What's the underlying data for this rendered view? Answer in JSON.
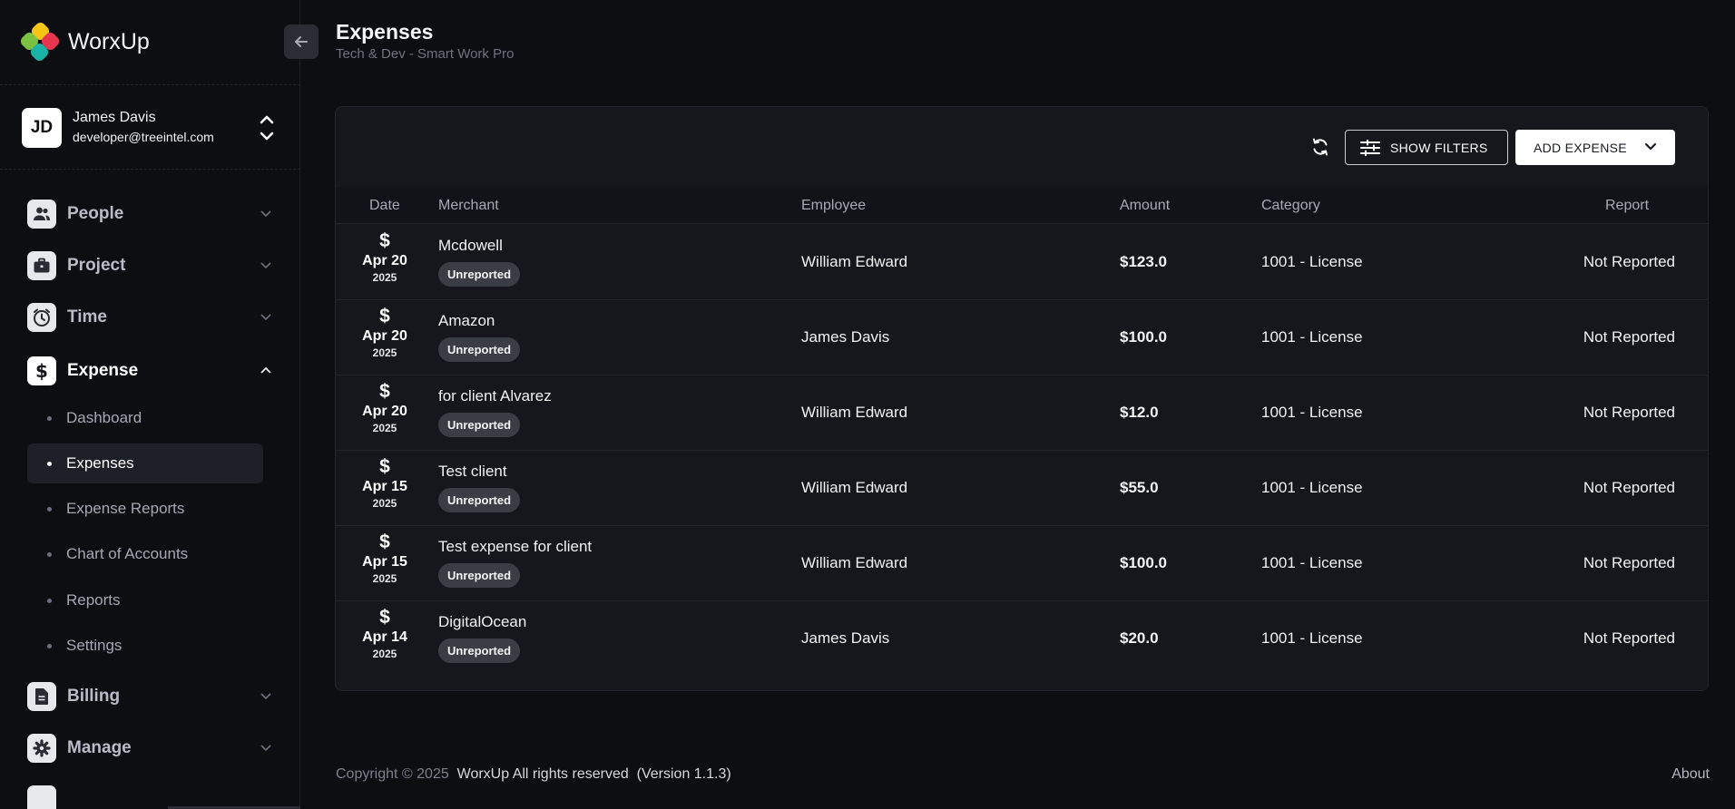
{
  "brand": {
    "name": "WorxUp",
    "logo_colors": [
      "#f5c518",
      "#7cc142",
      "#e8364f",
      "#1bb3a6"
    ]
  },
  "user": {
    "initials": "JD",
    "name": "James Davis",
    "email": "developer@treeintel.com"
  },
  "nav": {
    "people": {
      "label": "People",
      "icon": "people-icon"
    },
    "project": {
      "label": "Project",
      "icon": "briefcase-icon"
    },
    "time": {
      "label": "Time",
      "icon": "clock-icon"
    },
    "expense": {
      "label": "Expense",
      "icon": "dollar-icon",
      "expanded": true,
      "sub": [
        {
          "label": "Dashboard"
        },
        {
          "label": "Expenses",
          "active": true
        },
        {
          "label": "Expense Reports"
        },
        {
          "label": "Chart of Accounts"
        },
        {
          "label": "Reports"
        },
        {
          "label": "Settings"
        }
      ]
    },
    "billing": {
      "label": "Billing",
      "icon": "document-icon"
    },
    "manage": {
      "label": "Manage",
      "icon": "gear-icon"
    }
  },
  "header": {
    "title": "Expenses",
    "subtitle": "Tech & Dev - Smart Work Pro"
  },
  "toolbar": {
    "show_filters": "SHOW FILTERS",
    "add_expense": "ADD EXPENSE"
  },
  "table": {
    "columns": {
      "date": "Date",
      "merchant": "Merchant",
      "employee": "Employee",
      "amount": "Amount",
      "category": "Category",
      "report": "Report"
    },
    "rows": [
      {
        "symbol": "$",
        "date": "Apr 20",
        "year": "2025",
        "merchant": "Mcdowell",
        "status": "Unreported",
        "employee": "William Edward",
        "amount": "$123.0",
        "category": "1001 - License",
        "report": "Not Reported"
      },
      {
        "symbol": "$",
        "date": "Apr 20",
        "year": "2025",
        "merchant": "Amazon",
        "status": "Unreported",
        "employee": "James Davis",
        "amount": "$100.0",
        "category": "1001 - License",
        "report": "Not Reported"
      },
      {
        "symbol": "$",
        "date": "Apr 20",
        "year": "2025",
        "merchant": "for client Alvarez",
        "status": "Unreported",
        "employee": "William Edward",
        "amount": "$12.0",
        "category": "1001 - License",
        "report": "Not Reported"
      },
      {
        "symbol": "$",
        "date": "Apr 15",
        "year": "2025",
        "merchant": "Test client",
        "status": "Unreported",
        "employee": "William Edward",
        "amount": "$55.0",
        "category": "1001 - License",
        "report": "Not Reported"
      },
      {
        "symbol": "$",
        "date": "Apr 15",
        "year": "2025",
        "merchant": "Test expense for client",
        "status": "Unreported",
        "employee": "William Edward",
        "amount": "$100.0",
        "category": "1001 - License",
        "report": "Not Reported"
      },
      {
        "symbol": "$",
        "date": "Apr 14",
        "year": "2025",
        "merchant": "DigitalOcean",
        "status": "Unreported",
        "employee": "James Davis",
        "amount": "$20.0",
        "category": "1001 - License",
        "report": "Not Reported"
      }
    ]
  },
  "footer": {
    "copyright": "Copyright © 2025",
    "brand_text": "WorxUp All rights reserved",
    "version": "(Version 1.1.3)",
    "about": "About"
  }
}
